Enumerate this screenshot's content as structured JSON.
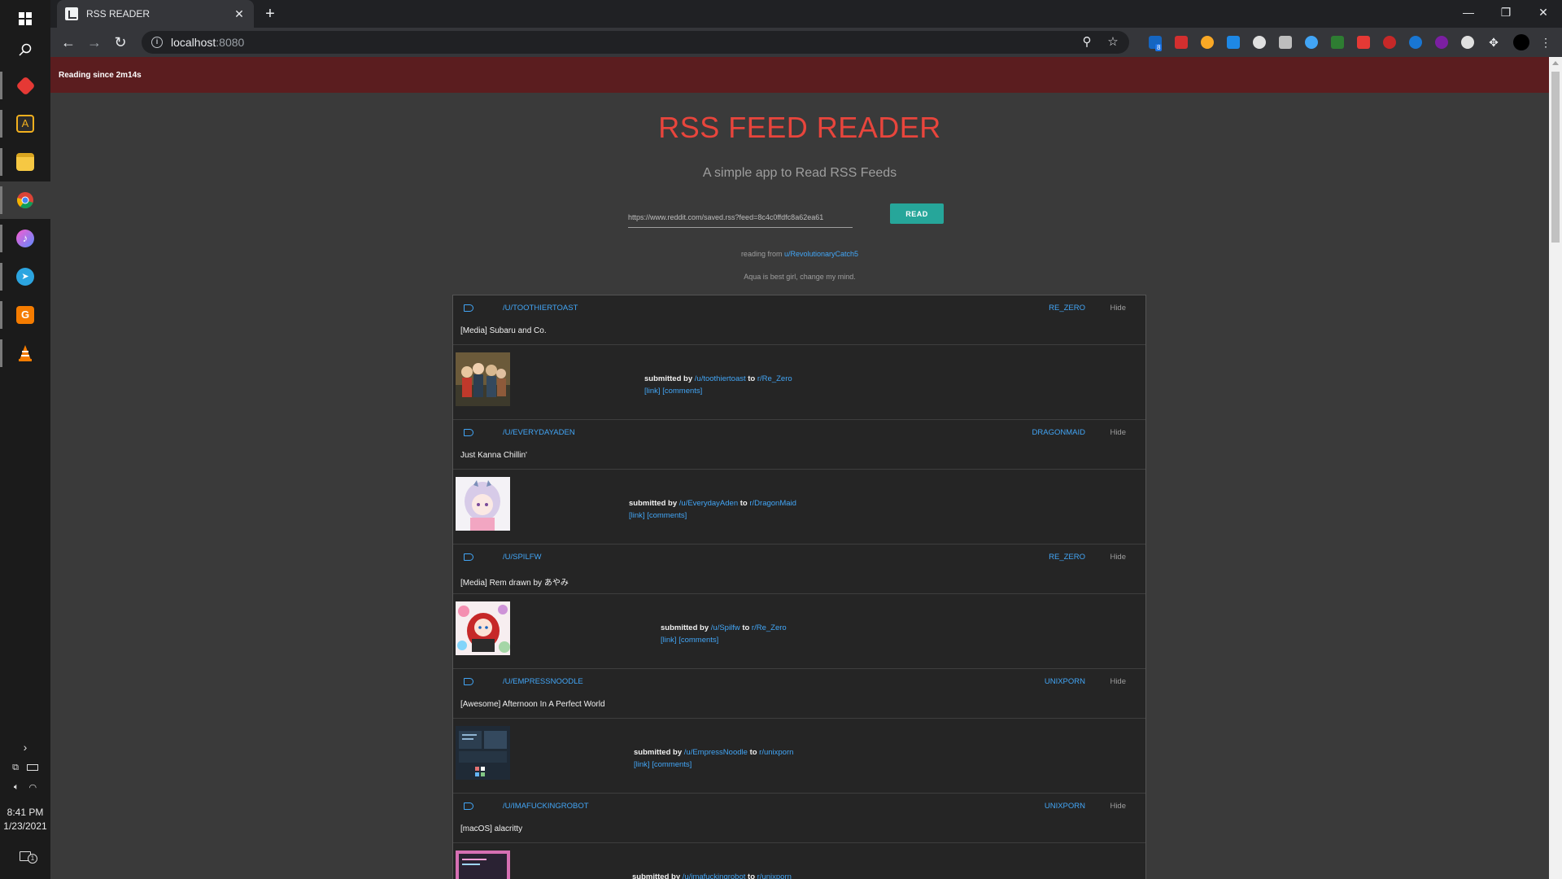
{
  "taskbar": {
    "time": "8:41 PM",
    "date": "1/23/2021",
    "notification_count": "1"
  },
  "browser": {
    "tab_title": "RSS READER",
    "url_host": "localhost",
    "url_port": ":8080",
    "extension_badge": "8"
  },
  "page": {
    "banner": "Reading since 2m14s",
    "title": "RSS FEED READER",
    "subtitle": "A simple app to Read RSS Feeds",
    "feed_url": "https://www.reddit.com/saved.rss?feed=8c4c0ffdfc8a62ea61",
    "read_label": "READ",
    "reading_from_prefix": "reading from",
    "reading_from_user": "u/RevolutionaryCatch5",
    "tagline": "Aqua is best girl, change my mind."
  },
  "feed": [
    {
      "author": "/u/toothiertoast",
      "subreddit": "re_zero",
      "hide": "Hide",
      "title": "[Media] Subaru and Co.",
      "submitted": "submitted by",
      "user": "/u/toothiertoast",
      "to": "to",
      "sub": "r/Re_Zero",
      "link": "[link]",
      "comments": "[comments]"
    },
    {
      "author": "/u/EverydayAden",
      "subreddit": "dragonmaid",
      "hide": "Hide",
      "title": "Just Kanna Chillin'",
      "submitted": "submitted by",
      "user": "/u/EverydayAden",
      "to": "to",
      "sub": "r/DragonMaid",
      "link": "[link]",
      "comments": "[comments]"
    },
    {
      "author": "/u/Spilfw",
      "subreddit": "re_zero",
      "hide": "Hide",
      "title": "[Media] Rem drawn by あやみ",
      "submitted": "submitted by",
      "user": "/u/Spilfw",
      "to": "to",
      "sub": "r/Re_Zero",
      "link": "[link]",
      "comments": "[comments]"
    },
    {
      "author": "/u/EmpressNoodle",
      "subreddit": "unixporn",
      "hide": "Hide",
      "title": "[Awesome] Afternoon In A Perfect World",
      "submitted": "submitted by",
      "user": "/u/EmpressNoodle",
      "to": "to",
      "sub": "r/unixporn",
      "link": "[link]",
      "comments": "[comments]"
    },
    {
      "author": "/u/imafuckingrobot",
      "subreddit": "unixporn",
      "hide": "Hide",
      "title": "[macOS] alacritty",
      "submitted": "submitted by",
      "user": "/u/imafuckingrobot",
      "to": "to",
      "sub": "r/unixporn",
      "link": "",
      "comments": ""
    }
  ],
  "colors": {
    "accent_red": "#e8453c",
    "banner_bg": "#5b1d1f",
    "read_button": "#26a69a",
    "link_blue": "#42a5f5"
  }
}
